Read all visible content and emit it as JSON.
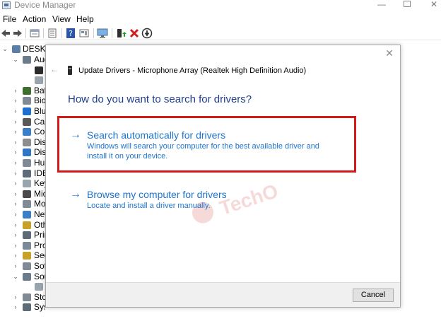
{
  "window": {
    "title": "Device Manager",
    "min_glyph": "—",
    "close_glyph": "✕"
  },
  "menu": [
    "File",
    "Action",
    "View",
    "Help"
  ],
  "toolbar": {
    "buttons": [
      "back-icon",
      "forward-icon",
      "properties-icon",
      "show-hide-icon",
      "help-icon",
      "details-icon",
      "scan-hardware-icon",
      "update-driver-icon",
      "uninstall-icon",
      "disable-icon"
    ]
  },
  "tree": {
    "root": "DESKTO",
    "items": [
      {
        "label": "Aud",
        "expanded": true,
        "color": "#6b7b8c"
      },
      {
        "label": "",
        "child": true,
        "color": "#2b2b2b"
      },
      {
        "label": "",
        "child": true,
        "color": "#9aa4ad"
      },
      {
        "label": "Batt",
        "color": "#3f6e2f"
      },
      {
        "label": "Bion",
        "color": "#7f8a94"
      },
      {
        "label": "Blue",
        "color": "#1f6fd1"
      },
      {
        "label": "Cam",
        "color": "#5a5a5a"
      },
      {
        "label": "Com",
        "color": "#3c7fc6"
      },
      {
        "label": "Disk",
        "color": "#8d8d8d"
      },
      {
        "label": "Disp",
        "color": "#2f76c4"
      },
      {
        "label": "Hum",
        "color": "#7f8a94"
      },
      {
        "label": "IDE",
        "color": "#5d6b78"
      },
      {
        "label": "Keyl",
        "color": "#9aa4ad"
      },
      {
        "label": "Mic",
        "color": "#4a4a4a"
      },
      {
        "label": "Mo",
        "color": "#7f8a94"
      },
      {
        "label": "Net",
        "color": "#3c7fc6"
      },
      {
        "label": "Oth",
        "color": "#c7a12a"
      },
      {
        "label": "Prin",
        "color": "#5d6b78"
      },
      {
        "label": "Pro",
        "color": "#7a8a98"
      },
      {
        "label": "Secu",
        "color": "#c7a12a"
      },
      {
        "label": "Soft",
        "color": "#7f8a94"
      },
      {
        "label": "Sou",
        "expanded": true,
        "color": "#6b7b8c"
      },
      {
        "label": "",
        "child": true,
        "color": "#9aa4ad"
      },
      {
        "label": "Stor",
        "color": "#7f8a94"
      },
      {
        "label": "System devices",
        "color": "#5d6b78"
      }
    ]
  },
  "dialog": {
    "title": "Update Drivers - Microphone Array (Realtek High Definition Audio)",
    "question": "How do you want to search for drivers?",
    "close_glyph": "✕",
    "back_glyph": "←",
    "options": [
      {
        "arrow": "→",
        "title": "Search automatically for drivers",
        "description": "Windows will search your computer for the best available driver and install it on your device."
      },
      {
        "arrow": "→",
        "title": "Browse my computer for drivers",
        "description": "Locate and install a driver manually."
      }
    ],
    "cancel_label": "Cancel",
    "highlight_color": "#d41a1a"
  },
  "watermark": {
    "text": "TechO"
  }
}
